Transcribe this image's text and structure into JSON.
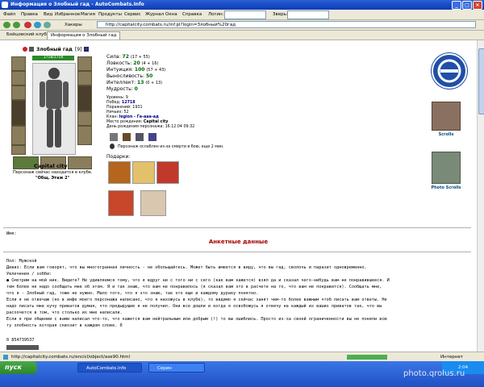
{
  "window": {
    "title": "Информация о Злобный гад - AutoCombats.Info"
  },
  "menu": {
    "items": [
      "Файл",
      "Правка",
      "Вид",
      "Избранное",
      "Магия",
      "Продукты",
      "Сервис",
      "Журнал",
      "Окна",
      "Справка"
    ],
    "login_label": "Логин:",
    "beast_label": "Зверь:"
  },
  "nav": {
    "favorites_label": "Хакеры",
    "address": "http://capitalcity.combats.ru/inf.pl?login=Злобный%20гад"
  },
  "tabs": [
    "Бойцовский клуб",
    "Информация о Злобный гад"
  ],
  "character": {
    "name": "Злобный гад",
    "level": "[9]",
    "hp": "1718/1718",
    "city": "Capital city",
    "presence": "Персонаж сейчас находится в клубе.",
    "room": "\"Общ. Этаж 2\""
  },
  "stats": [
    {
      "label": "Сила:",
      "value": "72",
      "extra": "(17 + 55)"
    },
    {
      "label": "Ловкость:",
      "value": "20",
      "extra": "(4 + 16)"
    },
    {
      "label": "Интуиция:",
      "value": "100",
      "extra": "(57 + 43)"
    },
    {
      "label": "Выносливость:",
      "value": "50",
      "extra": ""
    },
    {
      "label": "Интеллект:",
      "value": "13",
      "extra": "(0 + 13)"
    },
    {
      "label": "Мудрость:",
      "value": "0",
      "extra": ""
    }
  ],
  "info": {
    "level": "Уровень: 9",
    "wins_label": "Побед:",
    "wins": "12718",
    "losses": "Поражений: 1931",
    "draws": "Ничьих: 52",
    "clan_label": "Клан:",
    "clan": "legion - Га-ааа-ад",
    "birthplace_label": "Место рождения:",
    "birthplace": "Capital city",
    "birthday": "День рождения персонажа: 16.12.04 09:32",
    "weakened": "Персонаж ослаблен из-за смерти в бою, еще 2 мин."
  },
  "gifts_label": "Подарки:",
  "right_panel": {
    "scrolls": "Scrolls",
    "photo_scrolls": "Photo Scrolls"
  },
  "anketa": {
    "title": "Анкетные данные",
    "name": "Имя:",
    "gender": "Пол: Мужской",
    "motto": "Девиз: Если вам говорят, что вы многогранная личность - не обольщайтесь. Может быть имеется в виду, что вы гад, сволочь и паразит одновременно.",
    "hobby_label": "Увлечения / хобби:",
    "hobby_lines": [
      "● Смотрим на мой ник. Видите? Не удивляемся тому, что я вдруг ни с того ни с сего (как вам кажется) взял да и сказал чего-нибудь вам не понравившееся. И",
      "тем более не надо сообщать мне об этом. Я и так знаю, что вам не понравилось (я сказал вам это в расчете на то, что вам не понравится). Сообщать мне,",
      "что я - Злобный гад, тоже не нужно. Мало того, что я это знаю, так это еще и каждому дураку понятно.",
      "Если я не отвечаю (но в инфе моего персонажа написано, что я нахожусь в клубе), то видимо я сейчас занят чем-то более важным чтоб писать вам ответы. Не",
      "надо писать мне кучу приватов думая, что предыдущие я не получил. Они все дошли и когда я освобожусь я отвечу на каждый из ваших приватов так, что вы",
      "расхочется в том, что столько их мне написали.",
      "Если я при общении с вами написал что-то, что кажется вам нейтральным или добрым (!) то вы ошиблись. Просто из-за своей ограниченности вы не поняли всю",
      "ту злобность которая сквозит в каждом слове. 0"
    ],
    "icq": "0 854739537"
  },
  "statusbar": {
    "url": "http://capitalcity.combats.ru/encicl/object/axe90.html",
    "zone": "Интернет"
  },
  "taskbar": {
    "start": "пуск",
    "tasks": [
      "AutoCombats.Info",
      "Серин"
    ],
    "clock": "2:04"
  },
  "watermark": "photo.qrolus.ru",
  "colors": {
    "title_red": "#a40000",
    "stat_green": "#006400",
    "link_blue": "#00008b"
  }
}
